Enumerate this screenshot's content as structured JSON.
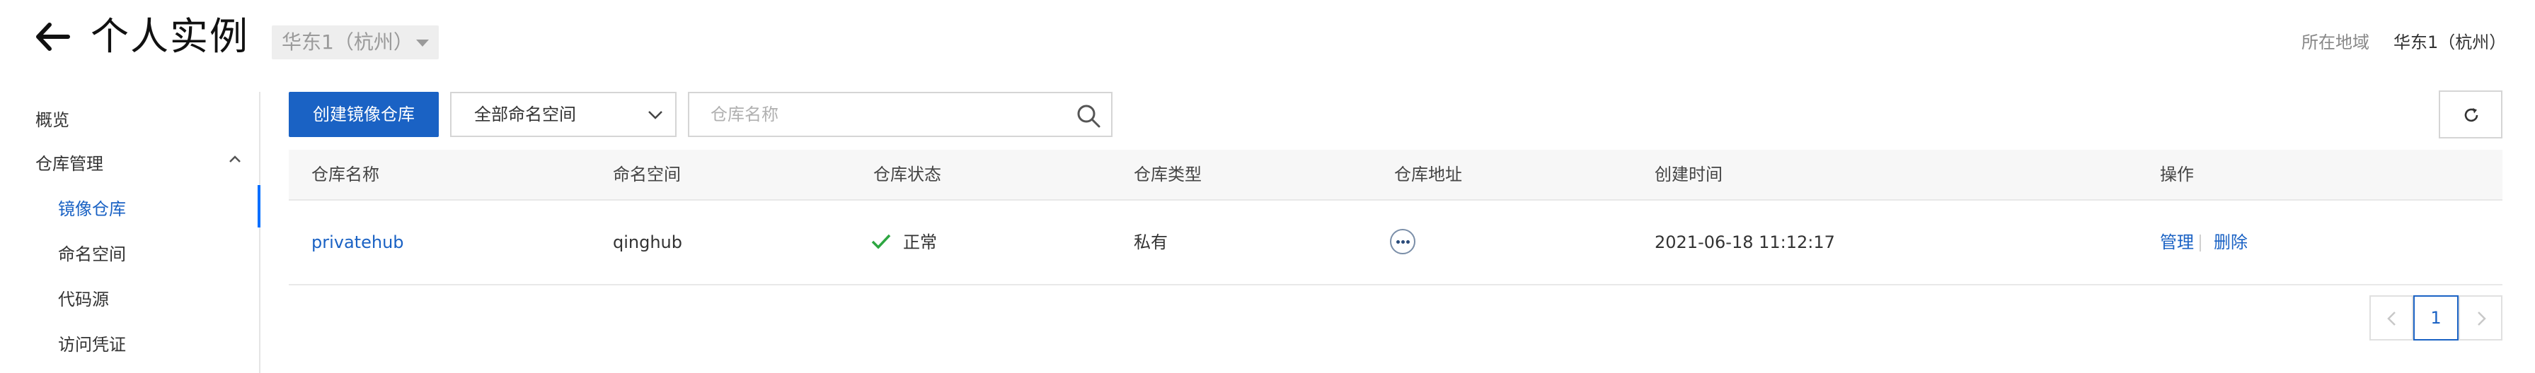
{
  "header": {
    "title": "个人实例",
    "region": "华东1（杭州）",
    "location_label": "所在地域",
    "location_value": "华东1（杭州）"
  },
  "sidebar": {
    "items": [
      {
        "label": "概览"
      },
      {
        "label": "仓库管理"
      },
      {
        "label": "镜像仓库",
        "active": true
      },
      {
        "label": "命名空间"
      },
      {
        "label": "代码源"
      },
      {
        "label": "访问凭证"
      }
    ]
  },
  "toolbar": {
    "create_label": "创建镜像仓库",
    "namespace_select": "全部命名空间",
    "search_placeholder": "仓库名称"
  },
  "table": {
    "columns": [
      "仓库名称",
      "命名空间",
      "仓库状态",
      "仓库类型",
      "仓库地址",
      "创建时间",
      "操作"
    ],
    "rows": [
      {
        "name": "privatehub",
        "namespace": "qinghub",
        "status": "正常",
        "type": "私有",
        "created": "2021-06-18 11:12:17",
        "actions": [
          "管理",
          "删除"
        ]
      }
    ]
  },
  "pagination": {
    "current_page": "1"
  },
  "icons": {
    "back": "arrow-left-icon",
    "search": "search-icon",
    "refresh": "refresh-icon",
    "status_ok": "check-icon",
    "address": "more-icon"
  },
  "colors": {
    "primary": "#1a62c4",
    "success": "#2da641",
    "active_indicator": "#006eff"
  }
}
